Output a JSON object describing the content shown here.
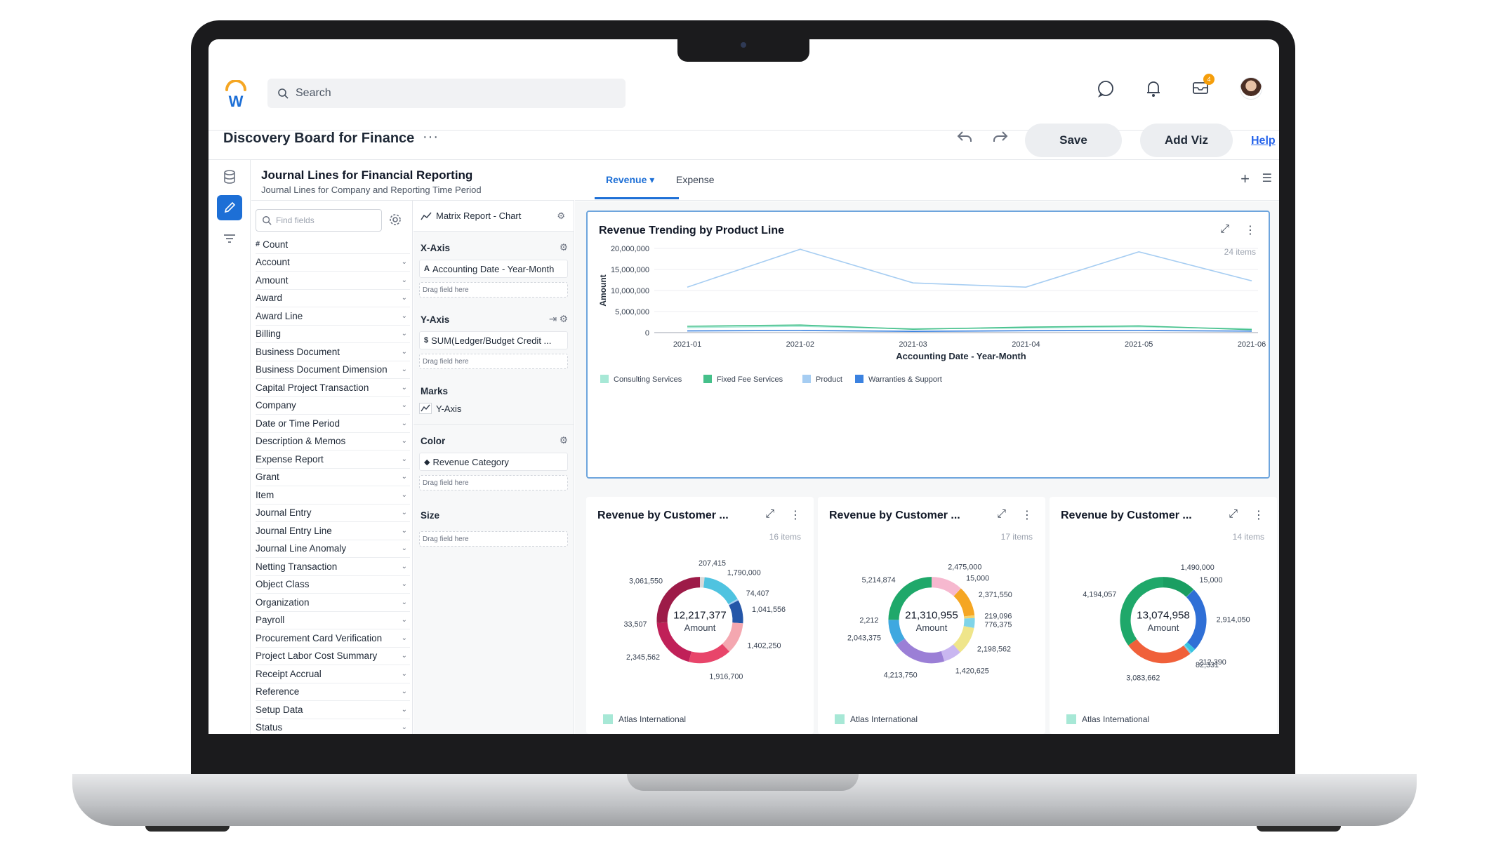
{
  "app": {
    "search_placeholder": "Search",
    "notification_badge": "4"
  },
  "title_bar": {
    "title": "Discovery Board for Finance",
    "more": "···",
    "save": "Save",
    "add_viz": "Add Viz",
    "help": "Help"
  },
  "source": {
    "title": "Journal Lines for Financial Reporting",
    "subtitle": "Journal Lines for Company and Reporting Time Period"
  },
  "fields": {
    "find_placeholder": "Find fields",
    "count_label": "Count",
    "items": [
      "Account",
      "Amount",
      "Award",
      "Award Line",
      "Billing",
      "Business Document",
      "Business Document Dimension",
      "Capital Project Transaction",
      "Company",
      "Date or Time Period",
      "Description & Memos",
      "Expense Report",
      "Grant",
      "Item",
      "Journal Entry",
      "Journal Entry Line",
      "Journal Line Anomaly",
      "Netting Transaction",
      "Object Class",
      "Organization",
      "Payroll",
      "Procurement Card Verification",
      "Project Labor Cost Summary",
      "Receipt Accrual",
      "Reference",
      "Setup Data",
      "Status"
    ]
  },
  "config": {
    "viz_type": "Matrix Report - Chart",
    "x_axis_label": "X-Axis",
    "x_axis_field": "Accounting Date - Year-Month",
    "y_axis_label": "Y-Axis",
    "y_axis_field": "SUM(Ledger/Budget Credit ...",
    "marks_label": "Marks",
    "marks_value": "Y-Axis",
    "color_label": "Color",
    "color_field": "Revenue Category",
    "size_label": "Size",
    "drag_hint": "Drag field here"
  },
  "tabs": {
    "revenue": "Revenue ▾",
    "expense": "Expense"
  },
  "line_chart_card": {
    "count_text": "24 items"
  },
  "chart_data": [
    {
      "type": "line",
      "title": "Revenue Trending by Product Line",
      "xlabel": "Accounting Date - Year-Month",
      "ylabel": "Amount",
      "x": [
        "2021-01",
        "2021-02",
        "2021-03",
        "2021-04",
        "2021-05",
        "2021-06"
      ],
      "yticks": [
        "0",
        "5,000,000",
        "10,000,000",
        "15,000,000",
        "20,000,000"
      ],
      "ylim": [
        0,
        20000000
      ],
      "legend_position": "bottom-left",
      "grid": true,
      "series": [
        {
          "name": "Consulting Services",
          "color": "#a7e8d6",
          "values": [
            1200000,
            1500000,
            900000,
            1100000,
            1400000,
            900000
          ]
        },
        {
          "name": "Fixed Fee Services",
          "color": "#45c08a",
          "values": [
            1500000,
            1800000,
            800000,
            1300000,
            1600000,
            700000
          ]
        },
        {
          "name": "Product",
          "color": "#a6cdf2",
          "values": [
            10800000,
            19800000,
            11800000,
            10800000,
            19200000,
            12300000
          ]
        },
        {
          "name": "Warranties & Support",
          "color": "#3b82e0",
          "values": [
            400000,
            500000,
            300000,
            450000,
            500000,
            350000
          ]
        }
      ]
    },
    {
      "type": "pie",
      "title": "Revenue by Customer ...",
      "count_text": "16 items",
      "center_value": "12,217,377",
      "center_label": "Amount",
      "legend": [
        "Atlas International"
      ],
      "slice_labels": [
        "207,415",
        "1,790,000",
        "74,407",
        "1,041,556",
        "1,402,250",
        "1,916,700",
        "2,345,562",
        "33,507",
        "3,061,550"
      ],
      "values": [
        207415,
        1790000,
        74407,
        1041556,
        1402250,
        1916700,
        2345562,
        33507,
        3061550
      ],
      "colors": [
        "#d9d9d9",
        "#4fc3e0",
        "#a6cdf2",
        "#2456a8",
        "#f4a7b0",
        "#e8456a",
        "#c02058",
        "#8a1e3a",
        "#9d1b48"
      ]
    },
    {
      "type": "pie",
      "title": "Revenue by Customer ...",
      "count_text": "17 items",
      "center_value": "21,310,955",
      "center_label": "Amount",
      "legend": [
        "Atlas International"
      ],
      "slice_labels": [
        "2,475,000",
        "15,000",
        "2,371,550",
        "219,096",
        "776,375",
        "2,198,562",
        "1,420,625",
        "4,213,750",
        "2,043,375",
        "2,212",
        "5,214,874"
      ],
      "values": [
        2475000,
        15000,
        2371550,
        219096,
        776375,
        2198562,
        1420625,
        4213750,
        2043375,
        2212,
        5214874
      ],
      "colors": [
        "#f6b8cf",
        "#f0c6d8",
        "#f5a623",
        "#f5d36b",
        "#7fd4e8",
        "#efe58a",
        "#c9b6f0",
        "#9b7fd6",
        "#3fa8e0",
        "#7ec87a",
        "#1fa86a"
      ]
    },
    {
      "type": "pie",
      "title": "Revenue by Customer ...",
      "count_text": "14 items",
      "center_value": "13,074,958",
      "center_label": "Amount",
      "legend": [
        "Atlas International"
      ],
      "slice_labels": [
        "1,490,000",
        "15,000",
        "2,914,050",
        "212,390",
        "82,331",
        "3,083,662",
        "4,194,057"
      ],
      "values": [
        1490000,
        15000,
        2914050,
        212390,
        82331,
        3083662,
        4194057
      ],
      "colors": [
        "#1a9e62",
        "#6fcf97",
        "#2f6fd6",
        "#38c4e0",
        "#7ad0ea",
        "#f0603a",
        "#1fa86a"
      ]
    }
  ]
}
